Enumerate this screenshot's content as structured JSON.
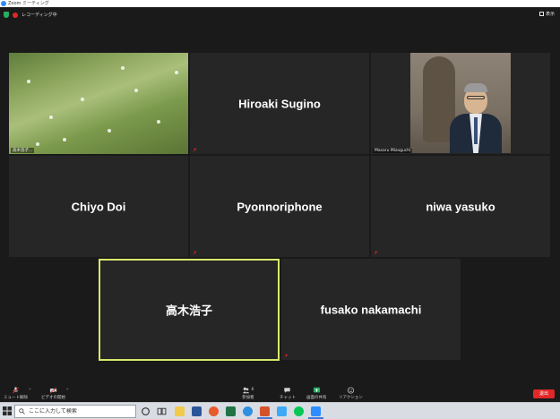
{
  "window": {
    "title": "Zoom ミーティング"
  },
  "topbar": {
    "recording_label": "レコーディング中",
    "view_label": "表示"
  },
  "participants": [
    {
      "id": "p1",
      "name": "",
      "label": "高木浩子...",
      "video": true
    },
    {
      "id": "p2",
      "name": "Hiroaki Sugino",
      "label": "",
      "video": false
    },
    {
      "id": "p3",
      "name": "",
      "label": "Masaru Mizoguchi",
      "video": true
    },
    {
      "id": "p4",
      "name": "Chiyo Doi",
      "label": "",
      "video": false
    },
    {
      "id": "p5",
      "name": "Pyonnoriphone",
      "label": "",
      "video": false
    },
    {
      "id": "p6",
      "name": "niwa yasuko",
      "label": "",
      "video": false
    },
    {
      "id": "p7",
      "name": "高木浩子",
      "label": "",
      "video": false,
      "active": true
    },
    {
      "id": "p8",
      "name": "fusako nakamachi",
      "label": "",
      "video": false
    }
  ],
  "toolbar": {
    "mute_label": "ミュート解除",
    "video_label": "ビデオの開始",
    "participants_label": "参加者",
    "participants_count": "8",
    "chat_label": "チャット",
    "share_label": "画面の共有",
    "reactions_label": "リアクション",
    "end_label": "退出"
  },
  "taskbar": {
    "search_placeholder": "ここに入力して検索"
  },
  "colors": {
    "zoom_blue": "#2d8cff",
    "end_red": "#e02828",
    "share_green": "#27ae60",
    "active_border": "#d9e86a"
  }
}
